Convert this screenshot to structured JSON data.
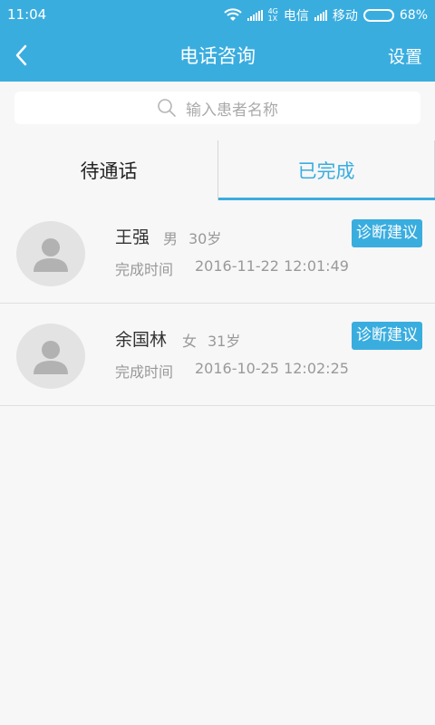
{
  "status_bar": {
    "time": "11:04",
    "net_top": "4G",
    "net_bottom": "1X",
    "carrier1": "电信",
    "carrier2": "移动",
    "battery": "68%",
    "battery_level": 0.68
  },
  "nav": {
    "title": "电话咨询",
    "settings_label": "设置"
  },
  "search": {
    "placeholder": "输入患者名称"
  },
  "tabs": [
    {
      "label": "待通话",
      "active": false
    },
    {
      "label": "已完成",
      "active": true
    }
  ],
  "records": [
    {
      "name": "王强",
      "gender": "男",
      "age": "30岁",
      "time_label": "完成时间",
      "time_value": "2016-11-22 12:01:49",
      "action_label": "诊断建议"
    },
    {
      "name": "余国林",
      "gender": "女",
      "age": "31岁",
      "time_label": "完成时间",
      "time_value": "2016-10-25 12:02:25",
      "action_label": "诊断建议"
    }
  ],
  "colors": {
    "accent": "#3aaddf",
    "background": "#f7f7f7"
  }
}
